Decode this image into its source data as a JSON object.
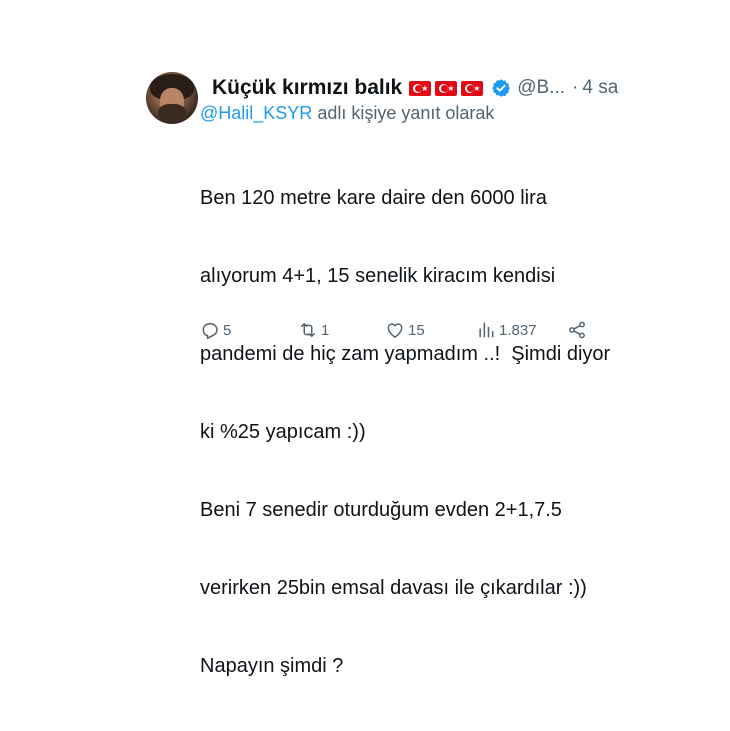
{
  "tweet": {
    "author_name": "Küçük kırmızı balık",
    "flags_count": 3,
    "handle": "@B...",
    "separator": "·",
    "time": "4 sa",
    "reply_to": {
      "mention": "@Halil_KSYR",
      "suffix": " adlı kişiye yanıt olarak"
    },
    "body_lines": [
      "Ben 120 metre kare daire den 6000 lira",
      "alıyorum 4+1, 15 senelik kiracım kendisi",
      "pandemi de hiç zam yapmadım ..!  Şimdi diyor",
      "ki %25 yapıcam :))",
      "Beni 7 senedir oturduğum evden 2+1,7.5",
      "verirken 25bin emsal davası ile çıkardılar :))",
      "Napayın şimdi ?"
    ],
    "actions": {
      "replies": "5",
      "retweets": "1",
      "likes": "15",
      "views": "1.837"
    },
    "colors": {
      "text": "#0f1419",
      "secondary": "#536471",
      "link": "#1d9bf0",
      "verified": "#1d9bf0",
      "flag": "#e30a17"
    }
  }
}
